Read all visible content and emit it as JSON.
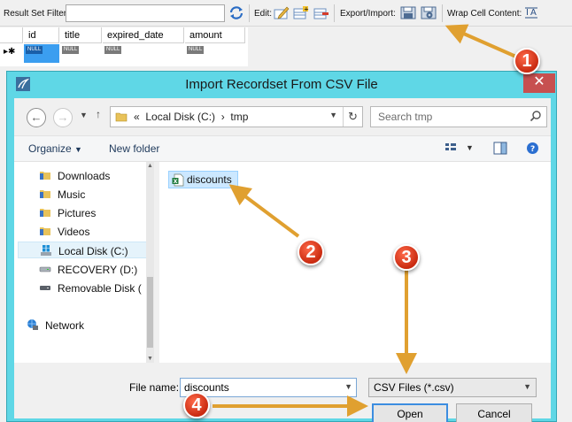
{
  "toolbar": {
    "filter_label": "Result Set Filter:",
    "filter_value": "",
    "edit_label": "Edit:",
    "export_label": "Export/Import:",
    "wrap_label": "Wrap Cell Content:"
  },
  "grid": {
    "columns": [
      "id",
      "title",
      "expired_date",
      "amount"
    ],
    "null_text": "NULL",
    "row_marker": "▸✱"
  },
  "dialog": {
    "title": "Import Recordset From CSV File",
    "close_glyph": "✕",
    "address": {
      "prefix": "«",
      "crumbs": [
        "Local Disk (C:)",
        "tmp"
      ],
      "separator": "›"
    },
    "search_placeholder": "Search tmp",
    "commands": {
      "organize": "Organize",
      "new_folder": "New folder"
    },
    "nav_items": [
      {
        "label": "Downloads",
        "icon": "downloads-folder-icon"
      },
      {
        "label": "Music",
        "icon": "music-folder-icon"
      },
      {
        "label": "Pictures",
        "icon": "pictures-folder-icon"
      },
      {
        "label": "Videos",
        "icon": "videos-folder-icon"
      },
      {
        "label": "Local Disk (C:)",
        "icon": "windows-drive-icon",
        "selected": true
      },
      {
        "label": "RECOVERY (D:)",
        "icon": "drive-icon"
      },
      {
        "label": "Removable Disk (",
        "icon": "removable-drive-icon"
      },
      {
        "label": "Network",
        "icon": "network-icon"
      }
    ],
    "files": [
      {
        "name": "discounts",
        "icon": "excel-csv-file-icon"
      }
    ],
    "file_name_label": "File name:",
    "file_name_value": "discounts",
    "file_type": "CSV Files (*.csv)",
    "open_label": "Open",
    "cancel_label": "Cancel"
  },
  "annotations": {
    "badges": [
      "1",
      "2",
      "3",
      "4"
    ],
    "arrow_color": "#e0a030",
    "badge_color": "#d9381e"
  },
  "colors": {
    "dialog_frame": "#5fd7e6",
    "close_button": "#c75050",
    "selection": "#cce8ff",
    "primary_button_border": "#3c8de0"
  }
}
